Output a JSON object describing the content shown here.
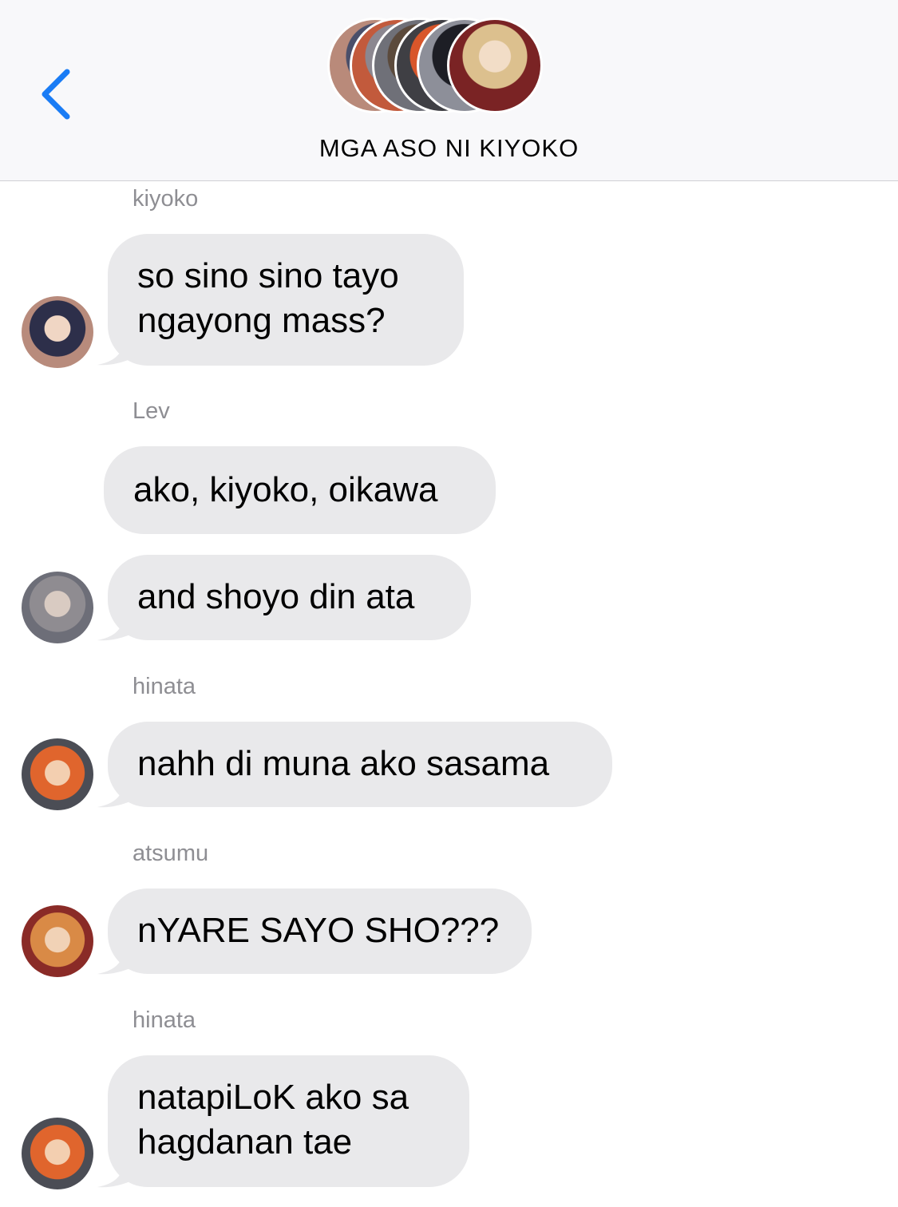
{
  "header": {
    "title": "MGA ASO NI KIYOKO",
    "back_icon": "chevron-left-icon",
    "accent": "#1a7cf5",
    "group_avatars": [
      "kiyoko",
      "lev",
      "oikawa",
      "hinata",
      "kageyama",
      "atsumu",
      "kenma"
    ]
  },
  "messages": [
    {
      "sender": "kiyoko",
      "bubbles": [
        {
          "lines": [
            "so sino sino tayo",
            "ngayong mass?"
          ]
        }
      ]
    },
    {
      "sender": "Lev",
      "bubbles": [
        {
          "lines": [
            "ako, kiyoko, oikawa"
          ]
        },
        {
          "lines": [
            "and shoyo din ata"
          ]
        }
      ]
    },
    {
      "sender": "hinata",
      "bubbles": [
        {
          "lines": [
            "nahh di muna ako sasama"
          ]
        }
      ]
    },
    {
      "sender": "atsumu",
      "bubbles": [
        {
          "lines": [
            "nYARE SAYO SHO???"
          ]
        }
      ]
    },
    {
      "sender": "hinata",
      "bubbles": [
        {
          "lines": [
            "natapiLoK ako sa",
            "hagdanan tae"
          ]
        }
      ]
    }
  ],
  "colors": {
    "bubble": "#e9e9eb",
    "sender_label": "#8e8e93",
    "header_bg": "#f8f8fa"
  }
}
